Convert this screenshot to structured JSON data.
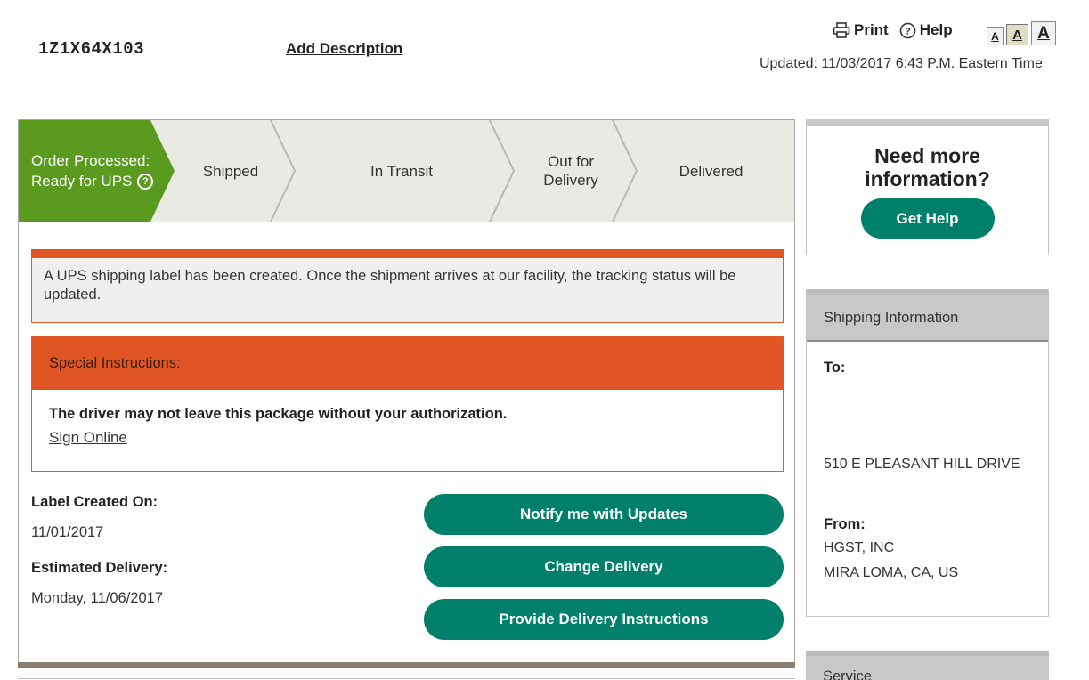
{
  "header": {
    "tracking_number": "1Z1X64X103",
    "add_description": "Add Description",
    "print_label": "Print",
    "help_label": "Help",
    "font_size_small": "A",
    "font_size_medium": "A",
    "font_size_large": "A",
    "updated": "Updated: 11/03/2017 6:43 P.M. Eastern Time"
  },
  "progress": {
    "current_step": "Order Processed: Ready for UPS",
    "current_line1": "Order Processed:",
    "current_line2": "Ready for UPS",
    "steps": [
      "Shipped",
      "In Transit",
      "Out for Delivery",
      "Delivered"
    ],
    "out_for_line1": "Out for",
    "out_for_line2": "Delivery"
  },
  "notice": {
    "text": "A UPS shipping label has been created. Once the shipment arrives at our facility, the tracking status will be updated."
  },
  "special_instructions": {
    "heading": "Special Instructions:",
    "text": "The driver may not leave this package without your authorization.",
    "link": "Sign Online"
  },
  "details": {
    "label_created_label": "Label Created On:",
    "label_created_value": "11/01/2017",
    "estimated_label": "Estimated Delivery:",
    "estimated_value": "Monday, 11/06/2017"
  },
  "actions": {
    "notify": "Notify me with Updates",
    "change": "Change Delivery",
    "instructions": "Provide Delivery Instructions"
  },
  "help_box": {
    "title_line1": "Need more",
    "title_line2": "information?",
    "button": "Get Help"
  },
  "shipping_info": {
    "heading": "Shipping Information",
    "to_label": "To:",
    "to_address": "510 E PLEASANT HILL DRIVE",
    "from_label": "From:",
    "from_name": "HGST, INC",
    "from_location": "MIRA LOMA,  CA,  US"
  },
  "service_box": {
    "heading": "Service"
  },
  "colors": {
    "green_active": "#5a9a1e",
    "teal_button": "#00806a",
    "orange": "#e05524",
    "progress_bg": "#eaeae5"
  }
}
